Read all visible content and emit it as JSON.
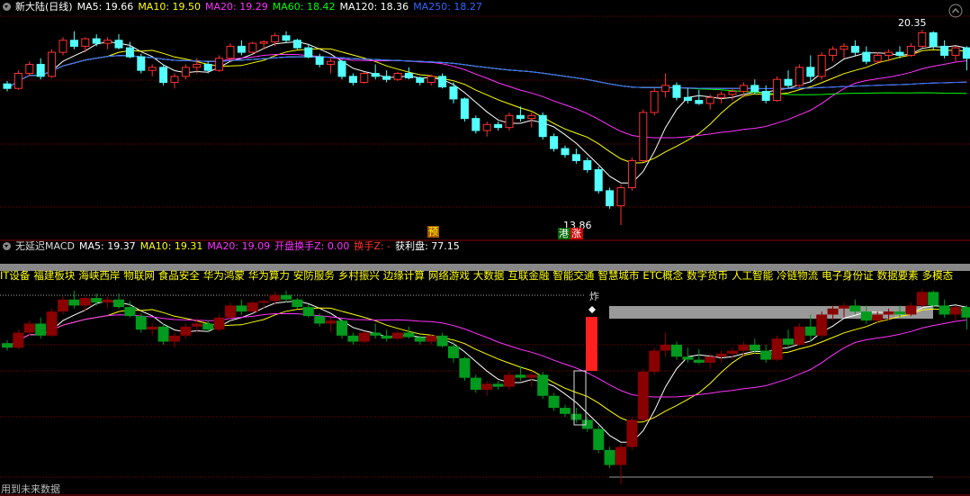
{
  "window_title": "新大陆(日线)",
  "main_indicators": [
    {
      "label": "MA5: 19.66",
      "color": "#ffffff"
    },
    {
      "label": "MA10: 19.50",
      "color": "#ffff00"
    },
    {
      "label": "MA20: 19.29",
      "color": "#ff33ff"
    },
    {
      "label": "MA60: 18.42",
      "color": "#00ff00"
    },
    {
      "label": "MA120: 18.36",
      "color": "#ffffff"
    },
    {
      "label": "MA250: 18.27",
      "color": "#3366ff"
    }
  ],
  "price_max_label": "20.35",
  "price_min_label": "13.86",
  "yu_label": "预",
  "gang_label": "港",
  "zhang_label": "涨",
  "zha_label": "炸",
  "sub_title": "无延迟MACD",
  "sub_indicators": [
    {
      "label": "MA5: 19.37",
      "color": "#ffffff"
    },
    {
      "label": "MA10: 19.31",
      "color": "#ffff00"
    },
    {
      "label": "MA20: 19.09",
      "color": "#ff33ff"
    },
    {
      "label": "开盘换手Z: 0.00",
      "color": "#ff33ff"
    },
    {
      "label": "换手Z: -",
      "color": "#ff3333"
    },
    {
      "label": "获利盘: 77.15",
      "color": "#ffffff"
    }
  ],
  "concepts": [
    "IT设备",
    "福建板块",
    "海峡西岸",
    "物联网",
    "食品安全",
    "华为鸿蒙",
    "华为算力",
    "安防服务",
    "乡村振兴",
    "边缘计算",
    "网络游戏",
    "大数据",
    "互联金融",
    "智能交通",
    "智慧城市",
    "ETC概念",
    "数字货币",
    "人工智能",
    "冷链物流",
    "电子身份证",
    "数据要素",
    "多模态"
  ],
  "footer_text": "用到未来数据",
  "colors": {
    "up": "#ff3232",
    "down": "#54ffff",
    "sub_up": "#8a0000",
    "sub_down": "#009a1e",
    "gridline": "#8b0000"
  },
  "chart_data": {
    "type": "candlestick",
    "title": "新大陆(日线)",
    "price_range": [
      13.5,
      20.8
    ],
    "candles": [
      [
        18.55,
        18.65,
        18.3,
        18.4
      ],
      [
        18.4,
        19.0,
        18.35,
        18.9
      ],
      [
        18.9,
        19.3,
        18.8,
        19.2
      ],
      [
        19.2,
        19.4,
        18.7,
        18.8
      ],
      [
        18.8,
        19.7,
        18.75,
        19.6
      ],
      [
        19.6,
        20.1,
        19.5,
        20.0
      ],
      [
        20.0,
        20.3,
        19.7,
        19.8
      ],
      [
        19.8,
        20.1,
        19.6,
        20.05
      ],
      [
        20.05,
        20.2,
        19.8,
        19.9
      ],
      [
        19.9,
        20.1,
        19.7,
        20.0
      ],
      [
        20.0,
        20.2,
        19.7,
        19.75
      ],
      [
        19.75,
        19.95,
        19.4,
        19.45
      ],
      [
        19.45,
        19.55,
        18.9,
        19.0
      ],
      [
        19.0,
        19.2,
        18.8,
        19.1
      ],
      [
        19.1,
        19.2,
        18.5,
        18.6
      ],
      [
        18.6,
        18.9,
        18.4,
        18.8
      ],
      [
        18.8,
        19.2,
        18.7,
        19.1
      ],
      [
        19.1,
        19.4,
        18.9,
        19.2
      ],
      [
        19.2,
        19.3,
        18.9,
        19.0
      ],
      [
        19.0,
        19.5,
        18.95,
        19.4
      ],
      [
        19.4,
        19.9,
        19.3,
        19.8
      ],
      [
        19.8,
        20.0,
        19.5,
        19.6
      ],
      [
        19.6,
        19.95,
        19.55,
        19.9
      ],
      [
        19.9,
        20.0,
        19.7,
        19.95
      ],
      [
        19.95,
        20.25,
        19.8,
        20.15
      ],
      [
        20.15,
        20.3,
        19.9,
        20.0
      ],
      [
        20.0,
        20.05,
        19.7,
        19.75
      ],
      [
        19.75,
        19.85,
        19.4,
        19.45
      ],
      [
        19.45,
        19.55,
        19.1,
        19.2
      ],
      [
        19.2,
        19.4,
        18.9,
        19.3
      ],
      [
        19.3,
        19.35,
        18.7,
        18.8
      ],
      [
        18.8,
        18.9,
        18.5,
        18.6
      ],
      [
        18.6,
        18.95,
        18.55,
        18.9
      ],
      [
        18.9,
        19.2,
        18.7,
        18.8
      ],
      [
        18.8,
        19.0,
        18.6,
        18.7
      ],
      [
        18.7,
        18.95,
        18.65,
        18.9
      ],
      [
        18.9,
        19.1,
        18.7,
        18.75
      ],
      [
        18.75,
        18.8,
        18.5,
        18.6
      ],
      [
        18.6,
        18.85,
        18.5,
        18.8
      ],
      [
        18.8,
        18.9,
        18.4,
        18.45
      ],
      [
        18.45,
        18.6,
        17.9,
        18.05
      ],
      [
        18.05,
        18.1,
        17.3,
        17.4
      ],
      [
        17.4,
        17.5,
        16.9,
        17.0
      ],
      [
        17.0,
        17.3,
        16.8,
        17.2
      ],
      [
        17.2,
        17.3,
        17.0,
        17.1
      ],
      [
        17.1,
        17.6,
        17.0,
        17.5
      ],
      [
        17.5,
        17.8,
        17.3,
        17.4
      ],
      [
        17.4,
        17.6,
        17.1,
        17.5
      ],
      [
        17.5,
        17.6,
        16.7,
        16.8
      ],
      [
        16.8,
        16.9,
        16.3,
        16.4
      ],
      [
        16.4,
        16.5,
        16.1,
        16.2
      ],
      [
        16.2,
        16.4,
        15.9,
        16.0
      ],
      [
        16.0,
        16.1,
        15.6,
        15.7
      ],
      [
        15.7,
        15.8,
        14.9,
        15.0
      ],
      [
        15.0,
        15.1,
        14.4,
        14.5
      ],
      [
        14.5,
        15.2,
        13.86,
        15.1
      ],
      [
        15.1,
        16.1,
        15.0,
        16.0
      ],
      [
        16.0,
        17.7,
        15.95,
        17.6
      ],
      [
        17.6,
        18.4,
        17.5,
        18.3
      ],
      [
        18.3,
        18.9,
        18.1,
        18.5
      ],
      [
        18.5,
        18.6,
        18.0,
        18.1
      ],
      [
        18.1,
        18.4,
        17.9,
        18.0
      ],
      [
        18.0,
        18.35,
        17.85,
        17.9
      ],
      [
        17.9,
        18.2,
        17.7,
        18.1
      ],
      [
        18.1,
        18.3,
        17.9,
        18.2
      ],
      [
        18.2,
        18.4,
        18.0,
        18.3
      ],
      [
        18.3,
        18.6,
        18.1,
        18.5
      ],
      [
        18.5,
        18.7,
        18.2,
        18.3
      ],
      [
        18.3,
        18.5,
        17.9,
        18.0
      ],
      [
        18.0,
        18.8,
        17.95,
        18.7
      ],
      [
        18.7,
        19.0,
        18.4,
        18.5
      ],
      [
        18.5,
        19.2,
        18.45,
        19.1
      ],
      [
        19.1,
        19.5,
        18.6,
        18.8
      ],
      [
        18.8,
        19.6,
        18.7,
        19.5
      ],
      [
        19.5,
        19.8,
        19.3,
        19.7
      ],
      [
        19.7,
        19.9,
        19.4,
        19.8
      ],
      [
        19.8,
        20.0,
        19.5,
        19.6
      ],
      [
        19.6,
        19.8,
        19.2,
        19.3
      ],
      [
        19.3,
        19.6,
        19.2,
        19.5
      ],
      [
        19.5,
        19.7,
        19.3,
        19.6
      ],
      [
        19.6,
        19.8,
        19.4,
        19.5
      ],
      [
        19.5,
        19.9,
        19.45,
        19.8
      ],
      [
        19.8,
        20.35,
        19.75,
        20.25
      ],
      [
        20.25,
        20.3,
        19.7,
        19.8
      ],
      [
        19.8,
        20.0,
        19.4,
        19.5
      ],
      [
        19.5,
        19.8,
        19.3,
        19.75
      ],
      [
        19.75,
        19.8,
        19.0,
        19.4
      ]
    ],
    "ma_series": [
      {
        "name": "MA5",
        "color": "#ffffff"
      },
      {
        "name": "MA10",
        "color": "#ffff00"
      },
      {
        "name": "MA20",
        "color": "#ff33ff"
      },
      {
        "name": "MA60",
        "color": "#00ff00"
      },
      {
        "name": "MA120",
        "color": "#ffffff"
      },
      {
        "name": "MA250",
        "color": "#3366ff"
      }
    ],
    "sub_chart_title": "无延迟MACD"
  }
}
